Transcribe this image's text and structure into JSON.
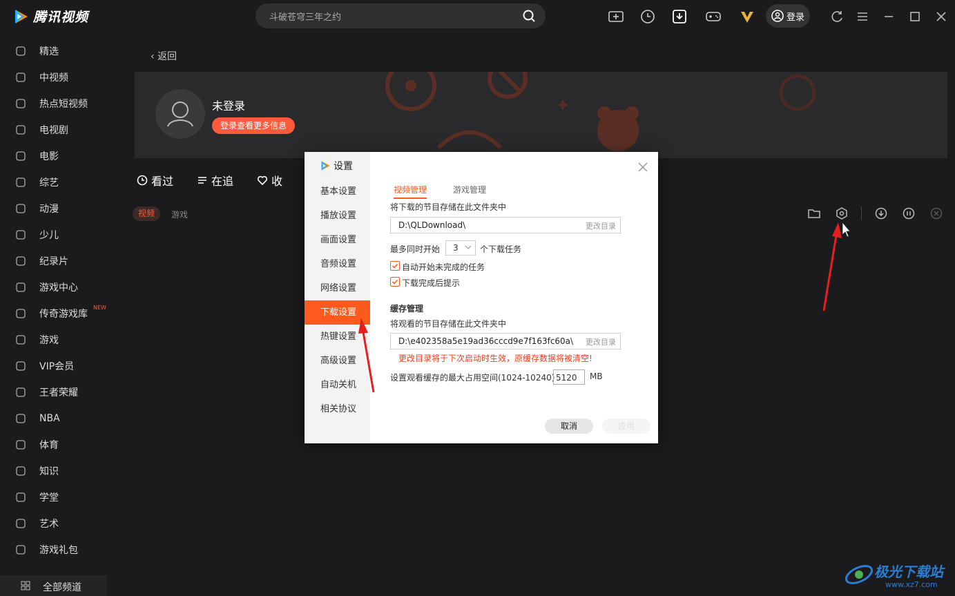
{
  "app": {
    "name": "腾讯视频"
  },
  "search": {
    "placeholder": "斗破苍穹三年之约"
  },
  "header": {
    "login_label": "登录"
  },
  "sidebar": {
    "items": [
      {
        "label": "精选",
        "icon": "thumbs-up-icon"
      },
      {
        "label": "中视频",
        "icon": "play-square-icon"
      },
      {
        "label": "热点短视频",
        "icon": "flame-icon"
      },
      {
        "label": "电视剧",
        "icon": "tv-icon"
      },
      {
        "label": "电影",
        "icon": "film-reel-icon"
      },
      {
        "label": "综艺",
        "icon": "microphone-icon"
      },
      {
        "label": "动漫",
        "icon": "bear-face-icon"
      },
      {
        "label": "少儿",
        "icon": "rocking-horse-icon"
      },
      {
        "label": "纪录片",
        "icon": "camera-icon"
      },
      {
        "label": "游戏中心",
        "icon": "gamepad-icon"
      },
      {
        "label": "传奇游戏库",
        "icon": "legend-icon",
        "badge": "NEW"
      },
      {
        "label": "游戏",
        "icon": "joystick-icon"
      },
      {
        "label": "VIP会员",
        "icon": "vip-icon"
      },
      {
        "label": "王者荣耀",
        "icon": "compass-icon"
      },
      {
        "label": "NBA",
        "icon": "nba-icon"
      },
      {
        "label": "体育",
        "icon": "ball-icon"
      },
      {
        "label": "知识",
        "icon": "book-icon"
      },
      {
        "label": "学堂",
        "icon": "mortarboard-icon"
      },
      {
        "label": "艺术",
        "icon": "palette-icon"
      },
      {
        "label": "游戏礼包",
        "icon": "gift-icon"
      }
    ],
    "all_channels": "全部频道"
  },
  "main": {
    "back_label": "返回",
    "username": "未登录",
    "login_more": "登录查看更多信息",
    "tabs": [
      {
        "label": "看过",
        "icon": "clock-icon"
      },
      {
        "label": "在追",
        "icon": "list-icon"
      },
      {
        "label": "收",
        "icon": "heart-icon"
      }
    ],
    "filters": {
      "video": "视频",
      "game": "游戏"
    }
  },
  "dialog": {
    "title": "设置",
    "nav": [
      "基本设置",
      "播放设置",
      "画面设置",
      "音频设置",
      "网络设置",
      "下载设置",
      "热键设置",
      "高级设置",
      "自动关机",
      "相关协议"
    ],
    "active_nav": "下载设置",
    "subtabs": {
      "video": "视频管理",
      "game": "游戏管理"
    },
    "download_folder_label": "将下载的节目存储在此文件夹中",
    "download_path": "D:\\QLDownload\\",
    "change_dir": "更改目录",
    "max_concurrent_prefix": "最多同时开始",
    "max_concurrent_value": "3",
    "max_concurrent_suffix": "个下载任务",
    "auto_start": "自动开始未完成的任务",
    "notify_done": "下载完成后提示",
    "cache_title": "缓存管理",
    "cache_folder_label": "将观看的节目存储在此文件夹中",
    "cache_path": "D:\\e402358a5e19ad36cccd9e7f163fc60a\\",
    "cache_warning": "更改目录将于下次启动时生效，原缓存数据将被清空!",
    "cache_max_label": "设置观看缓存的最大占用空间(1024-10240)",
    "cache_max_value": "5120",
    "cache_unit": "MB",
    "cancel": "取消",
    "apply": "应用"
  },
  "watermark": {
    "text": "极光下载站",
    "url": "www.xz7.com"
  },
  "colors": {
    "accent": "#ff5a1e",
    "bg": "#1b1b1d"
  }
}
